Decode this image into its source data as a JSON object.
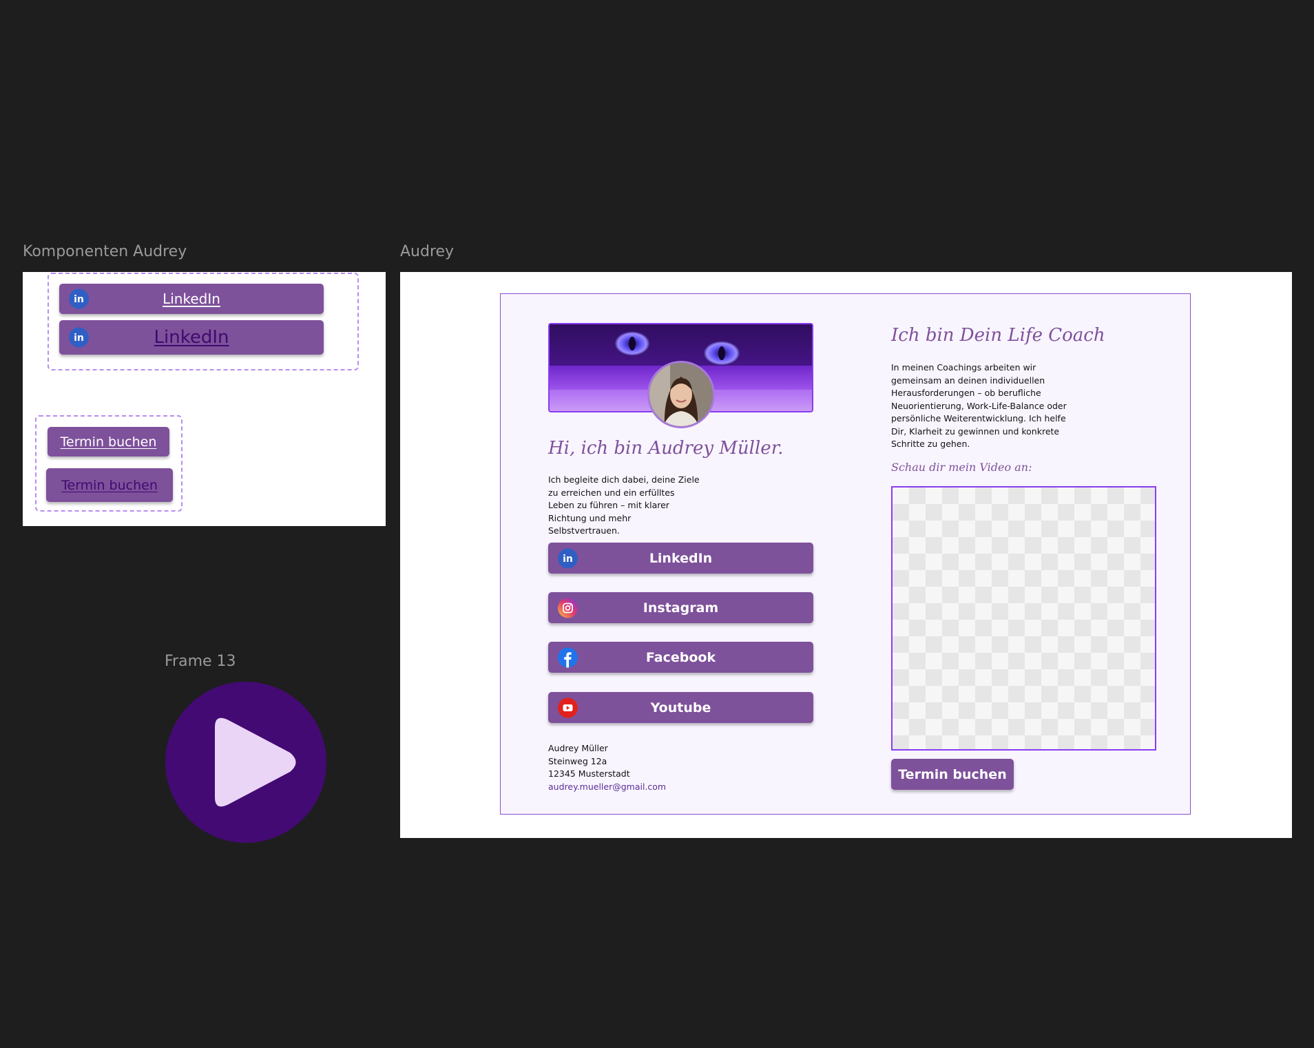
{
  "canvas": {
    "frames": {
      "components": "Komponenten Audrey",
      "page": "Audrey",
      "frame13": "Frame 13"
    }
  },
  "components": {
    "linkedin_default": "LinkedIn",
    "linkedin_hover": "LinkedIn",
    "termin_default": "Termin buchen",
    "termin_hover": "Termin buchen"
  },
  "profile": {
    "greeting": "Hi, ich bin Audrey Müller.",
    "intro": "Ich begleite dich dabei, deine Ziele zu erreichen und ein erfülltes Leben zu führen – mit klarer Richtung und mehr Selbstvertrauen."
  },
  "social": [
    {
      "label": "LinkedIn",
      "icon": "linkedin-icon"
    },
    {
      "label": "Instagram",
      "icon": "instagram-icon"
    },
    {
      "label": "Facebook",
      "icon": "facebook-icon"
    },
    {
      "label": "Youtube",
      "icon": "youtube-icon"
    }
  ],
  "contact": {
    "name": "Audrey Müller",
    "street": "Steinweg 12a",
    "city": "12345 Musterstadt",
    "email": "audrey.mueller@gmail.com"
  },
  "coach": {
    "heading": "Ich bin Dein Life Coach",
    "text": "In meinen Coachings arbeiten wir gemeinsam an deinen individuellen Herausforderungen – ob berufliche Neuorientierung, Work-Life-Balance oder persönliche Weiterentwicklung. Ich helfe Dir, Klarheit zu gewinnen und konkrete Schritte zu gehen.",
    "video_label": "Schau dir mein Video an:",
    "cta": "Termin buchen"
  },
  "colors": {
    "canvas": "#1e1e1e",
    "button": "#7e519b",
    "accent_dark": "#3f0a70",
    "play_circle": "#430a73",
    "play_triangle": "#ead5f6",
    "page_bg": "#f9f5ff",
    "page_border": "#8a4dcf"
  }
}
